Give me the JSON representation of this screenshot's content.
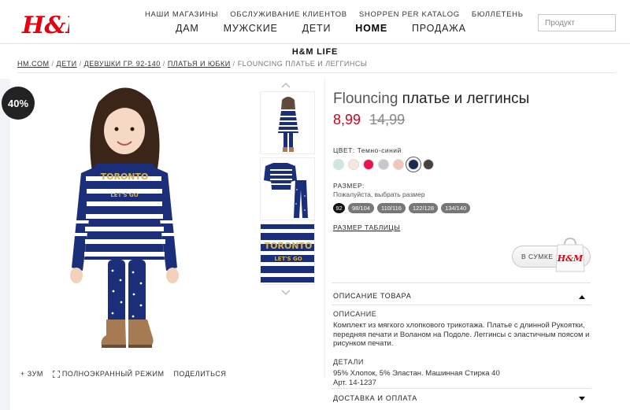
{
  "brand": {
    "logo_text": "H&M",
    "accent": "#e50010"
  },
  "header": {
    "top_links": [
      "НАШИ МАГАЗИНЫ",
      "ОБСЛУЖИВАНИЕ КЛИЕНТОВ",
      "SHOPPEN PER KATALOG",
      "БЮЛЛЕТЕНЬ"
    ],
    "nav": [
      "ДАМ",
      "МУЖСКИЕ",
      "ДЕТИ",
      "HOME",
      "ПРОДАЖА"
    ],
    "active_nav": "HOME",
    "search_placeholder": "Продукт",
    "section_title": "H&M LIFE"
  },
  "breadcrumb": {
    "items": [
      "HM.COM",
      "ДЕТИ",
      "ДЕВУШКИ ГР. 92-140",
      "ПЛАТЬЯ И ЮБКИ"
    ],
    "separator": "/",
    "current": "FLOUNCING ПЛАТЬЕ И ЛЕГГИНСЫ"
  },
  "gallery": {
    "discount_badge": "40%",
    "tools": {
      "zoom": "ЗУМ",
      "fullscreen": "ПОЛНОЭКРАННЫЙ РЕЖИМ",
      "share": "ПОДЕЛИТЬСЯ"
    },
    "print_text": "TORONTO",
    "print_sub": "LET'S GO"
  },
  "product": {
    "title_brand": "Flouncing",
    "title_rest": "платье и леггинсы",
    "price_new": "8,99",
    "price_old": "14,99",
    "price_color": "#d0021b",
    "color_label": "ЦВЕТ:",
    "color_value": "Темно-синий",
    "swatches": [
      "#cfe8df",
      "#f6e7dc",
      "#e8144e",
      "#c5c8cc",
      "#f3c5b8",
      "#1b2a52",
      "#4a423e"
    ],
    "selected_swatch": 5,
    "size_label": "РАЗМЕР:",
    "size_hint": "Пожалуйста, выбрать размер",
    "sizes": [
      "92",
      "98/104",
      "110/116",
      "122/128",
      "134/140"
    ],
    "size_chart": "РАЗМЕР ТАБЛИЦЫ",
    "bag_button": "В СУМКЕ",
    "bag_logo": "H&M"
  },
  "description": {
    "section_title": "ОПИСАНИЕ ТОВАРА",
    "desc_title": "ОПИСАНИЕ",
    "desc_text": "Комплект из мягкого хлопкового трикотажа. Платье с длинной Рукоятки, передняя печати и Воланом на Подоле. Леггинсы с эластичным поясом и рисунком печати.",
    "details_title": "ДЕТАЛИ",
    "details_line1": "95% Хлопок, 5% Эластан. Машинная Стирка 40",
    "details_line2": "Арт. 14-1237",
    "delivery_title": "ДОСТАВКА И ОПЛАТА"
  }
}
